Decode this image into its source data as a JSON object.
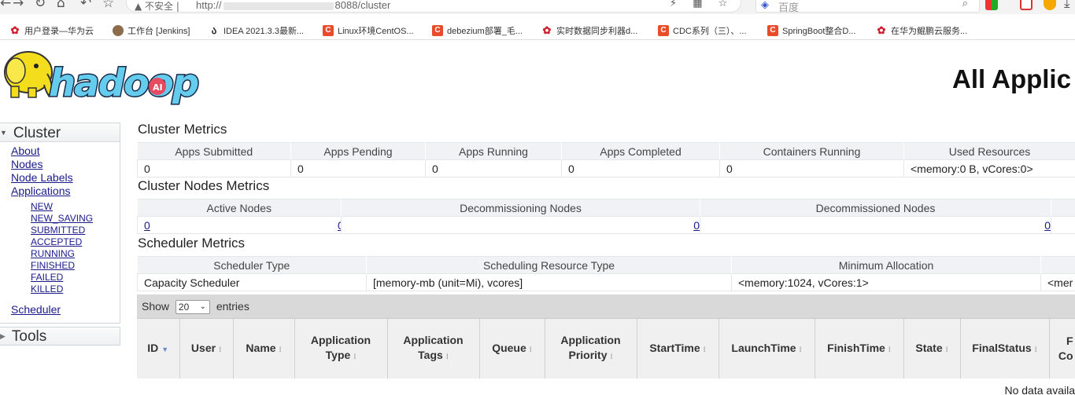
{
  "browser": {
    "url": "http://",
    "url_port_path": "8088/cluster",
    "security": "不安全",
    "search_placeholder": "百度",
    "bookmarks": [
      {
        "label": "用户登录—华为云",
        "icon": "huawei"
      },
      {
        "label": "工作台 [Jenkins]",
        "icon": "jenkins"
      },
      {
        "label": "IDEA 2021.3.3最新...",
        "icon": "idea"
      },
      {
        "label": "Linux环境CentOS...",
        "icon": "csdn"
      },
      {
        "label": "debezium部署_毛...",
        "icon": "csdn"
      },
      {
        "label": "实时数据同步利器d...",
        "icon": "huawei"
      },
      {
        "label": "CDC系列（三）、...",
        "icon": "csdn"
      },
      {
        "label": "SpringBoot整合D...",
        "icon": "csdn"
      },
      {
        "label": "在华为鲲鹏云服务...",
        "icon": "huawei"
      }
    ]
  },
  "page": {
    "title": "All Applic"
  },
  "nav": {
    "cluster_label": "Cluster",
    "links": [
      "About",
      "Nodes",
      "Node Labels",
      "Applications"
    ],
    "app_states": [
      "NEW",
      "NEW_SAVING",
      "SUBMITTED",
      "ACCEPTED",
      "RUNNING",
      "FINISHED",
      "FAILED",
      "KILLED"
    ],
    "scheduler_link": "Scheduler",
    "tools_label": "Tools"
  },
  "cluster_metrics": {
    "title": "Cluster Metrics",
    "headers": [
      "Apps Submitted",
      "Apps Pending",
      "Apps Running",
      "Apps Completed",
      "Containers Running",
      "Used Resources"
    ],
    "values": [
      "0",
      "0",
      "0",
      "0",
      "0",
      "<memory:0 B, vCores:0>"
    ]
  },
  "node_metrics": {
    "title": "Cluster Nodes Metrics",
    "headers": [
      "Active Nodes",
      "Decommissioning Nodes",
      "Decommissioned Nodes",
      ""
    ],
    "values": [
      "0",
      "0",
      "0",
      "0"
    ]
  },
  "scheduler_metrics": {
    "title": "Scheduler Metrics",
    "headers": [
      "Scheduler Type",
      "Scheduling Resource Type",
      "Minimum Allocation",
      ""
    ],
    "values": [
      "Capacity Scheduler",
      "[memory-mb (unit=Mi), vcores]",
      "<memory:1024, vCores:1>",
      "<mer"
    ]
  },
  "apps": {
    "show_label": "Show",
    "entries_value": "20",
    "entries_label": "entries",
    "columns": [
      "ID",
      "User",
      "Name",
      "Application Type",
      "Application Tags",
      "Queue",
      "Application Priority",
      "StartTime",
      "LaunchTime",
      "FinishTime",
      "State",
      "FinalStatus",
      "F Co"
    ],
    "empty_message": "No data availa"
  }
}
